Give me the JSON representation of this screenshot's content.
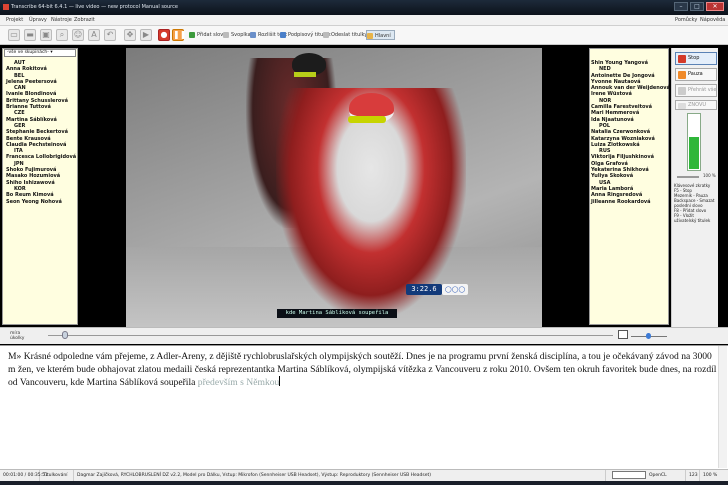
{
  "window": {
    "title": "Transcribe 64-bit 6.4.1 — live video — new protocol Manual source"
  },
  "menu": {
    "items": [
      "Projekt",
      "Úpravy",
      "Nástroje",
      "Zobrazit"
    ],
    "right": [
      "Pomůcky",
      "Nápověda"
    ]
  },
  "toolbar": {
    "icons": [
      "new-file-icon",
      "open-folder-icon",
      "save-icon",
      "search-icon",
      "users-icon",
      "spellcheck-icon",
      "undo-icon",
      "move-icon",
      "play-icon",
      "record-icon",
      "pause-icon"
    ],
    "buttons": [
      "Přidat slovo",
      "Svoplka",
      "Rozlišit text",
      "Podpisový titulek",
      "Odeslat titulky",
      "Hlavní"
    ]
  },
  "left_panel": {
    "select_value": "-vše ve skupinách-",
    "items": [
      {
        "text": "AUT",
        "country": true
      },
      {
        "text": "Anna Rokitová",
        "country": false
      },
      {
        "text": "BEL",
        "country": true
      },
      {
        "text": "Jelena Peetersová",
        "country": false
      },
      {
        "text": "CAN",
        "country": true
      },
      {
        "text": "Ivanie Blondinová",
        "country": false
      },
      {
        "text": "Brittany Schusslerová",
        "country": false
      },
      {
        "text": "Brianne Tuttová",
        "country": false
      },
      {
        "text": "CZE",
        "country": true
      },
      {
        "text": "Martina Sáblíková",
        "country": false
      },
      {
        "text": "GER",
        "country": true
      },
      {
        "text": "Stephanie Beckertová",
        "country": false
      },
      {
        "text": "Bente Krausová",
        "country": false
      },
      {
        "text": "Claudia Pechsteinová",
        "country": false
      },
      {
        "text": "ITA",
        "country": true
      },
      {
        "text": "Francesca Lollobrigidová",
        "country": false
      },
      {
        "text": "JPN",
        "country": true
      },
      {
        "text": "Shoko Fujimurová",
        "country": false
      },
      {
        "text": "Masako Hozumiová",
        "country": false
      },
      {
        "text": "Shiho Ishizawová",
        "country": false
      },
      {
        "text": "KOR",
        "country": true
      },
      {
        "text": "Bo Reum Kimová",
        "country": false
      },
      {
        "text": "Seon Yeong Nohová",
        "country": false
      }
    ]
  },
  "right_panel": {
    "items": [
      {
        "text": "Shin Young Yangová",
        "country": false
      },
      {
        "text": "NED",
        "country": true
      },
      {
        "text": "Antoinette De Jongová",
        "country": false
      },
      {
        "text": "Yvonne Nautaová",
        "country": false
      },
      {
        "text": "Annouk van der Weijdenová",
        "country": false
      },
      {
        "text": "Irene Wüstová",
        "country": false
      },
      {
        "text": "NOR",
        "country": true
      },
      {
        "text": "Camilla Farestveitová",
        "country": false
      },
      {
        "text": "Mari Hemmerová",
        "country": false
      },
      {
        "text": "Ida Njaatunová",
        "country": false
      },
      {
        "text": "POL",
        "country": true
      },
      {
        "text": "Natalia Czerwonková",
        "country": false
      },
      {
        "text": "Katarzyna Wozniaková",
        "country": false
      },
      {
        "text": "Luiza Zlotkowská",
        "country": false
      },
      {
        "text": "RUS",
        "country": true
      },
      {
        "text": "Viktorija Filjushkinová",
        "country": false
      },
      {
        "text": "Olga Grafová",
        "country": false
      },
      {
        "text": "Yekaterina Shikhová",
        "country": false
      },
      {
        "text": "Yuliya Skoková",
        "country": false
      },
      {
        "text": "USA",
        "country": true
      },
      {
        "text": "Maria Lamborá",
        "country": false
      },
      {
        "text": "Anna Ringsredová",
        "country": false
      },
      {
        "text": "Jilleanne Rookardová",
        "country": false
      }
    ]
  },
  "video": {
    "timer": "3:22.6",
    "olympic_rings": "◯◯◯",
    "subtitle": "kde Martina Sáblíková soupeřila"
  },
  "controls": {
    "stop": "Stop",
    "pause": "Pauza",
    "play": "Přehrát vše",
    "status": "ZNOVU",
    "volume_pct": "100 %",
    "volume_level": 0.6,
    "shortcuts": [
      "Klávesové zkratky",
      "F5 - Stop",
      "Mezerník - Pauza",
      "Backspace - Smazat",
      "   poslední slovo",
      "F8 - Přidat slovo",
      "F9 - Vložit",
      "   uživatelský titulek"
    ]
  },
  "timeline": {
    "label": "míra úkolky"
  },
  "editor": {
    "text": "M» Krásné odpoledne vám přejeme, z Adler-Areny, z dějiště rychlobruslařských olympijských soutěží. Dnes je na programu první ženská disciplína, a tou je očekávaný závod na 3000 m žen, ve kterém bude obhajovat zlatou medaili česká reprezentantka Martina Sáblíková, olympijská vítězka z Vancouveru z roku 2010. Ovšem ten okruh favoritek bude dnes, na rozdíl od Vancouveru, kde Martina Sáblíková soupeřila",
    "pending": "především s Němkou"
  },
  "statusbar": {
    "time": "00:01:00 / 00:35:51",
    "mode": "Titulkování",
    "info": "Dagmar Zajíčková, RYCHLOBRUSLENÍ DZ v2.2, Model pro Dálku, Vstup: Mikrofon (Sennheiser USB Headset), Výstup: Reproduktory (Sennheiser USB Headset)",
    "engine": "OpenCL",
    "count": "123",
    "zoom": "100 %"
  },
  "colors": {
    "accent": "#3d7bd6",
    "list_bg": "#fffee0",
    "record_red": "#d43a2a",
    "volume_green": "#2fb63a"
  }
}
